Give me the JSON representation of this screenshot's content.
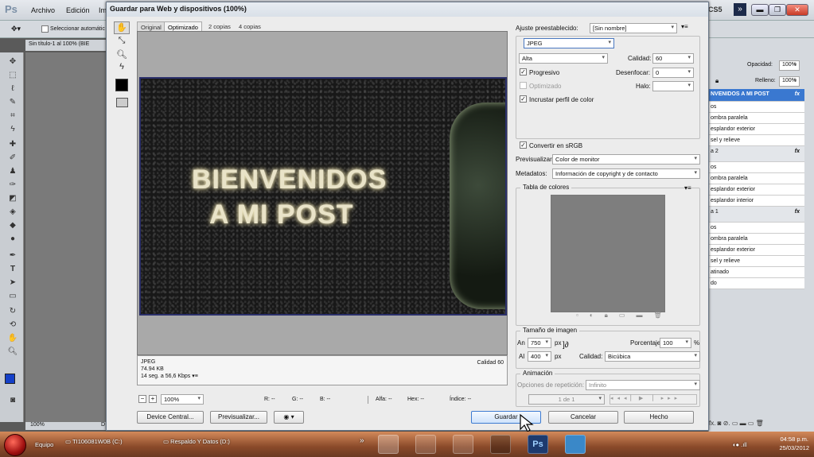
{
  "photoshop": {
    "logo": "Ps",
    "menu": [
      "Archivo",
      "Edición",
      "Im"
    ],
    "app_label": "CS5",
    "options": {
      "select_auto": "Seleccionar automátic"
    },
    "doc_tab": "Sin título-1 al 100% (BIE",
    "doc_zoom": "100%",
    "doc_status_d": "D",
    "layers": {
      "opacity_label": "Opacidad:",
      "opacity": "100%",
      "fill_label": "Relleno:",
      "fill": "100%",
      "rows": [
        {
          "text": "NVENIDOS   A MI POST",
          "selected": true,
          "fx": "fx"
        },
        {
          "text": "os"
        },
        {
          "text": "ombra paralela"
        },
        {
          "text": "esplandor exterior"
        },
        {
          "text": "sel y relieve"
        },
        {
          "text": "a 2",
          "fx": "fx"
        },
        {
          "text": "os"
        },
        {
          "text": "ombra paralela"
        },
        {
          "text": "esplandor exterior"
        },
        {
          "text": "esplandor interior"
        },
        {
          "text": "a 1",
          "fx": "fx"
        },
        {
          "text": "os"
        },
        {
          "text": "ombra paralela"
        },
        {
          "text": "esplandor exterior"
        },
        {
          "text": "sel y relieve"
        },
        {
          "text": "atinado"
        },
        {
          "text": "do"
        }
      ]
    }
  },
  "dialog": {
    "title": "Guardar para Web y dispositivos (100%)",
    "tabs": [
      "Original",
      "Optimizado",
      "2 copias",
      "4 copias"
    ],
    "image_text": {
      "line1": "BIENVENIDOS",
      "line2": "A MI POST"
    },
    "info": {
      "format": "JPEG",
      "size": "74.94 KB",
      "time": "14 seg. a 56,6 Kbps",
      "quality": "Calidad 60"
    },
    "zoom": "100%",
    "readouts": {
      "r": "R: --",
      "g": "G: --",
      "b": "B: --",
      "alpha": "Alfa: --",
      "hex": "Hex: --",
      "index": "Índice: --"
    },
    "buttons": {
      "device_central": "Device Central...",
      "preview": "Previsualizar...",
      "save": "Guardar",
      "cancel": "Cancelar",
      "done": "Hecho"
    },
    "settings": {
      "preset_label": "Ajuste preestablecido:",
      "preset": "[Sin nombre]",
      "format": "JPEG",
      "quality_level": "Alta",
      "quality_label": "Calidad:",
      "quality": "60",
      "progressive": "Progresivo",
      "blur_label": "Desenfocar:",
      "blur": "0",
      "optimized": "Optimizado",
      "matte_label": "Halo:",
      "embed_profile": "Incrustar perfil de color",
      "convert_srgb": "Convertir en sRGB",
      "preview_label": "Previsualizar:",
      "preview": "Color de monitor",
      "metadata_label": "Metadatos:",
      "metadata": "Información de copyright y de contacto",
      "color_table_label": "Tabla de colores",
      "image_size_label": "Tamaño de imagen",
      "width_label": "An",
      "width": "750",
      "height_label": "Al",
      "height": "400",
      "unit": "px",
      "percent_label": "Porcentaje:",
      "percent": "100",
      "percent_sign": "%",
      "resample_label": "Calidad:",
      "resample": "Bicúbica",
      "animation_label": "Animación",
      "loop_label": "Opciones de repetición:",
      "loop": "Infinito",
      "frame": "1 de 1"
    }
  },
  "taskbar": {
    "items": [
      "Equipo",
      "TI106081W0B (C:)",
      "Respaldo Y Datos (D:)"
    ],
    "time": "04:58 p.m.",
    "date": "25/03/2012"
  }
}
